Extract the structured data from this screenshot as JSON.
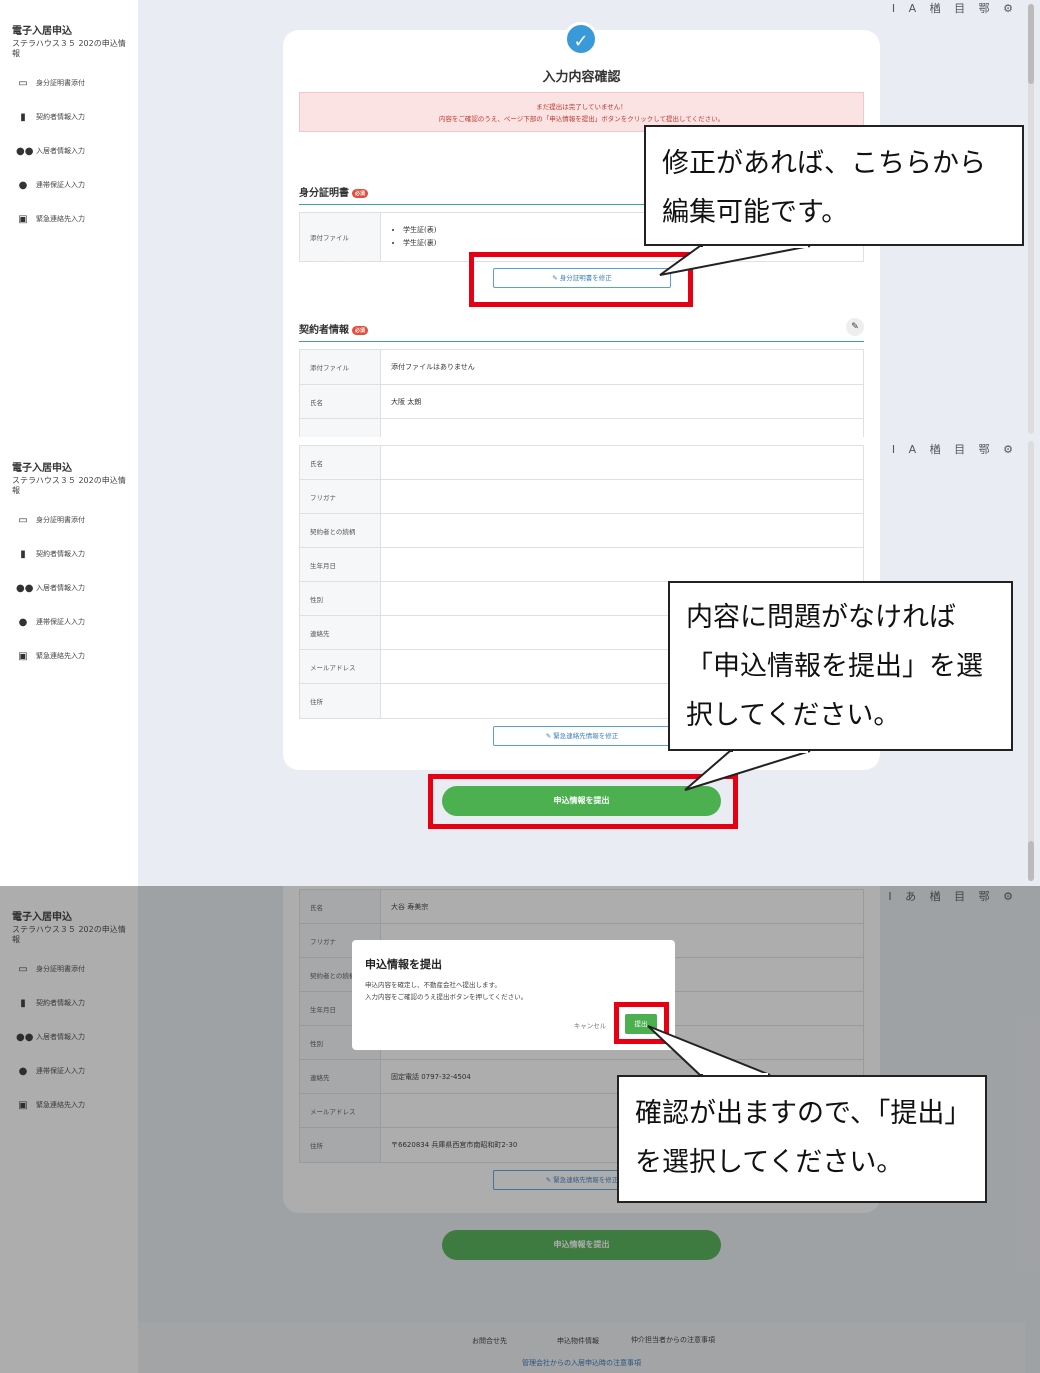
{
  "sidebar": {
    "title": "電子入居申込",
    "subtitle": "ステラハウス３５ 202の申込情報",
    "items": [
      {
        "label": "身分証明書添付",
        "icon": "id-card-icon"
      },
      {
        "label": "契約者情報入力",
        "icon": "document-icon"
      },
      {
        "label": "入居者情報入力",
        "icon": "users-icon"
      },
      {
        "label": "連帯保証人入力",
        "icon": "user-icon"
      },
      {
        "label": "緊急連絡先入力",
        "icon": "contact-book-icon"
      }
    ]
  },
  "toolbar": {
    "panel1": "Ι A 楢 目 鄂 ⚙",
    "panel2": "Ι A 楢 目 鄂 ⚙",
    "panel3": "Ι あ 楢 目 鄂 ⚙"
  },
  "confirm": {
    "title": "入力内容確認",
    "alert_line1": "まだ提出は完了していません！",
    "alert_line2": "内容をご確認のうえ、ページ下部の「申込情報を提出」ボタンをクリックして提出してください。",
    "badge": "必須",
    "id_section": {
      "title": "身分証明書",
      "rows": [
        {
          "label": "添付ファイル",
          "values": [
            "学生証(表)",
            "学生証(裏)"
          ]
        }
      ],
      "edit_label": "身分証明書を修正"
    },
    "contract_section": {
      "title": "契約者情報",
      "rows": [
        {
          "label": "添付ファイル",
          "value": "添付ファイルはありません"
        },
        {
          "label": "氏名",
          "value": "大阪 太朗"
        }
      ]
    }
  },
  "emergency": {
    "rows": [
      {
        "label": "氏名",
        "value": ""
      },
      {
        "label": "フリガナ",
        "value": ""
      },
      {
        "label": "契約者との続柄",
        "value": ""
      },
      {
        "label": "生年月日",
        "value": ""
      },
      {
        "label": "性別",
        "value": ""
      },
      {
        "label": "連絡先",
        "value": ""
      },
      {
        "label": "メールアドレス",
        "value": ""
      },
      {
        "label": "住所",
        "value": ""
      }
    ],
    "edit_label": "緊急連絡先情報を修正",
    "rows_filled": [
      {
        "label": "氏名",
        "value": "大谷 寿美宗"
      },
      {
        "label": "フリガナ",
        "value": ""
      },
      {
        "label": "契約者との続柄",
        "value": ""
      },
      {
        "label": "生年月日",
        "value": ""
      },
      {
        "label": "性別",
        "value": ""
      },
      {
        "label": "連絡先",
        "value": "固定電話 0797-32-4504"
      },
      {
        "label": "メールアドレス",
        "value": ""
      },
      {
        "label": "住所",
        "value": "〒6620834 兵庫県西宮市南昭和町2-30"
      }
    ]
  },
  "submit_label": "申込情報を提出",
  "modal": {
    "title": "申込情報を提出",
    "body_line1": "申込内容を確定し、不動産会社へ提出します。",
    "body_line2": "入力内容をご確認のうえ提出ボタンを押してください。",
    "cancel": "キャンセル",
    "ok": "提出"
  },
  "footer": {
    "link1": "お問合せ先",
    "link2": "申込物件情報",
    "link3": "仲介担当者からの注意事項",
    "note": "管理会社からの入居申込時の注意事項"
  },
  "callouts": {
    "c1": "修正があれば、こちらから編集可能です。",
    "c2": "内容に問題がなければ「申込情報を提出」を選択してください。",
    "c3": "確認が出ますので、「提出」を選択してください。"
  },
  "colors": {
    "accent_green": "#4caf50",
    "highlight_red": "#e60012",
    "check_blue": "#3a9ad9"
  }
}
